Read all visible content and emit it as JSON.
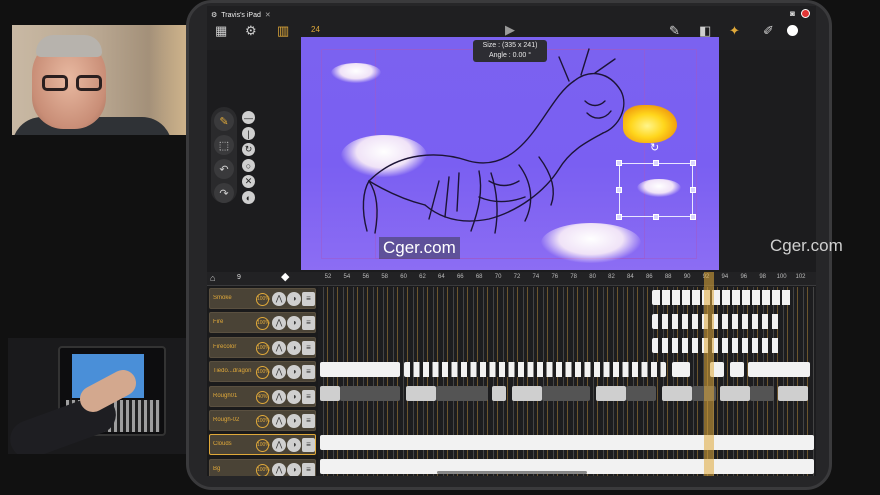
{
  "device": {
    "name": "Travis's iPad",
    "fps": "24",
    "size_readout": "Size : (335 x 241)",
    "angle_readout": "Angle : 0.00 °"
  },
  "watermarks": [
    "Cger.com",
    "Cger.com"
  ],
  "colors": {
    "accent": "#e0a93a",
    "canvas_bg": "#7b62f0",
    "timeline_bg": "#1a1a1b",
    "record": "#e03535"
  },
  "toolbar": {
    "icons": [
      "grid-icon",
      "gear-icon",
      "filmstrip-icon",
      "play-icon",
      "pencil-icon",
      "eraser-icon",
      "fill-brush-icon",
      "pen-icon",
      "color-swatch-icon"
    ]
  },
  "side_tools": {
    "icons": [
      "lasso-brush-icon",
      "selection-icon",
      "undo-icon",
      "redo-icon",
      "line-icon",
      "vertical-line-icon",
      "rotate-icon",
      "loop-icon",
      "cancel-icon",
      "half-circle-icon"
    ]
  },
  "timeline": {
    "current_frame": "9",
    "frames": [
      "52",
      "54",
      "56",
      "58",
      "60",
      "62",
      "64",
      "66",
      "68",
      "70",
      "72",
      "74",
      "76",
      "78",
      "80",
      "82",
      "84",
      "86",
      "88",
      "90",
      "92",
      "94",
      "96",
      "98",
      "100",
      "102"
    ],
    "layers": [
      {
        "name": "Smoke",
        "opacity": "100%"
      },
      {
        "name": "Fire",
        "opacity": "100%"
      },
      {
        "name": "Firecolor",
        "opacity": "100%"
      },
      {
        "name": "Tiedo...dragon",
        "opacity": "100%"
      },
      {
        "name": "Rough01",
        "opacity": "40%"
      },
      {
        "name": "Rough-02",
        "opacity": "100%"
      },
      {
        "name": "Clouds",
        "opacity": "100%"
      },
      {
        "name": "Bg",
        "opacity": "100%"
      }
    ]
  }
}
